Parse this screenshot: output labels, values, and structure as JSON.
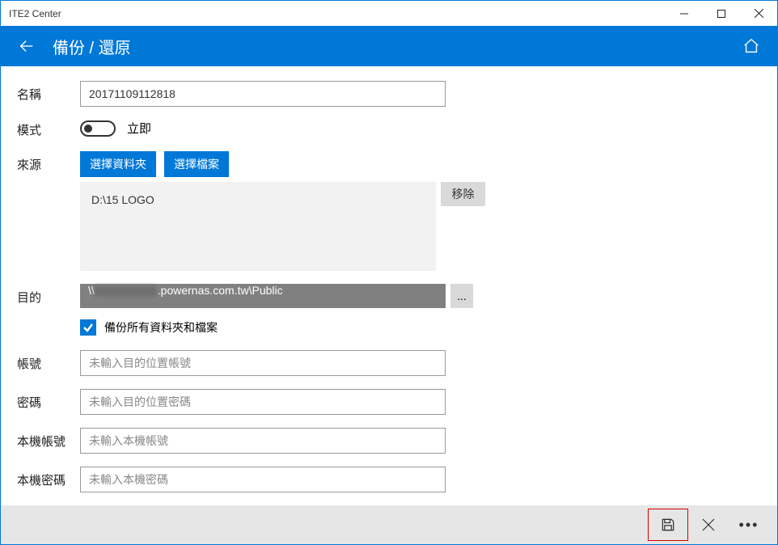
{
  "window": {
    "title": "ITE2 Center"
  },
  "header": {
    "title": "備份 / 還原"
  },
  "labels": {
    "name": "名稱",
    "mode": "模式",
    "source": "來源",
    "destination": "目的",
    "account": "帳號",
    "password": "密碼",
    "local_account": "本機帳號",
    "local_password": "本機密碼"
  },
  "values": {
    "name": "20171109112818",
    "mode_text": "立即",
    "select_folder_btn": "選擇資料夾",
    "select_file_btn": "選擇檔案",
    "source_path": "D:\\15 LOGO",
    "remove_btn": "移除",
    "destination_prefix": "\\\\",
    "destination_suffix": ".powernas.com.tw\\Public",
    "browse_btn": "...",
    "backup_all_label": "備份所有資料夾和檔案"
  },
  "placeholders": {
    "account": "未輸入目的位置帳號",
    "password": "未輸入目的位置密碼",
    "local_account": "未輸入本機帳號",
    "local_password": "未輸入本機密碼"
  }
}
